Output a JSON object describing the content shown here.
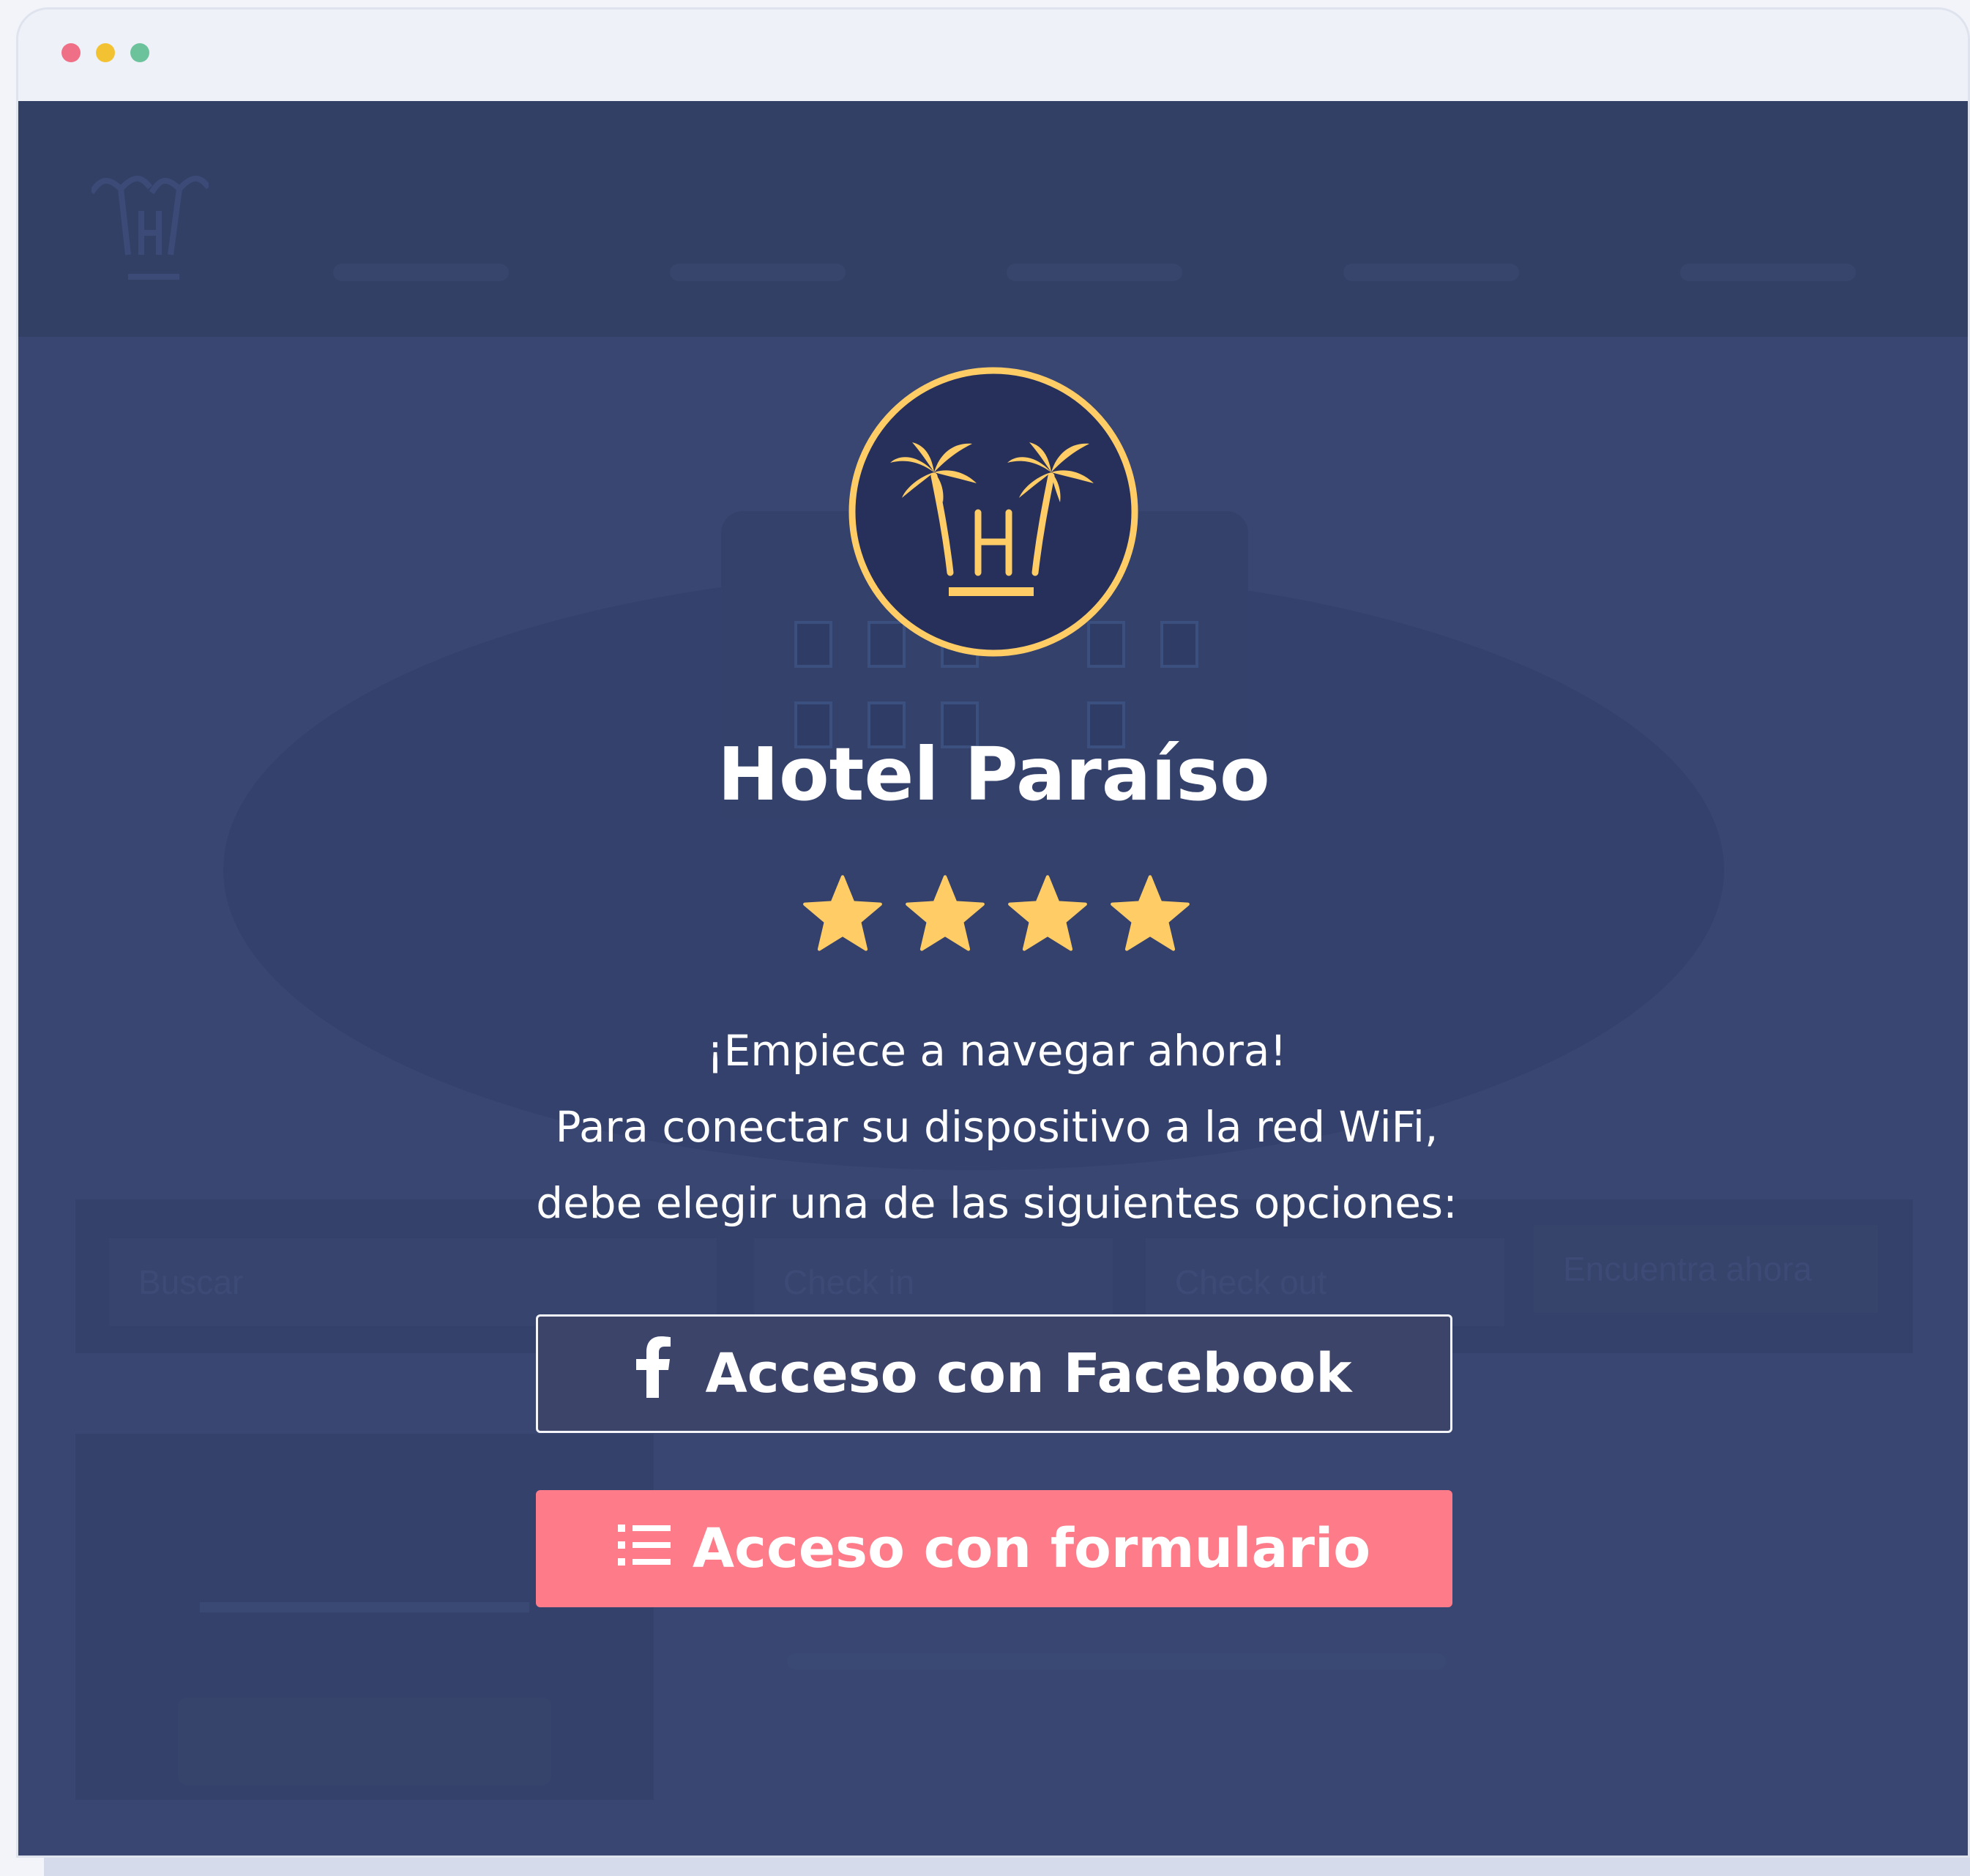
{
  "window": {
    "controls": [
      "close",
      "minimize",
      "maximize"
    ]
  },
  "background_page": {
    "search_placeholder": "Buscar",
    "check_in": "Check in",
    "check_out": "Check out",
    "find_button": "Encuentra ahora"
  },
  "portal": {
    "logo_icon": "palm-trees-hotel-logo",
    "hotel_name": "Hotel Paraíso",
    "star_rating": 4,
    "message_lines": [
      "¡Empiece a navegar ahora!",
      "Para conectar su dispositivo a la red WiFi,",
      "debe elegir una de las siguientes opciones:"
    ],
    "facebook_button": {
      "label": "Acceso con Facebook",
      "icon": "facebook-icon"
    },
    "form_button": {
      "label": "Acceso con formulario",
      "icon": "list-icon"
    }
  },
  "colors": {
    "background": "#384671",
    "accent_gold": "#ffcc66",
    "logo_fill": "#26305a",
    "form_button": "#fe7b89",
    "text": "#ffffff"
  }
}
